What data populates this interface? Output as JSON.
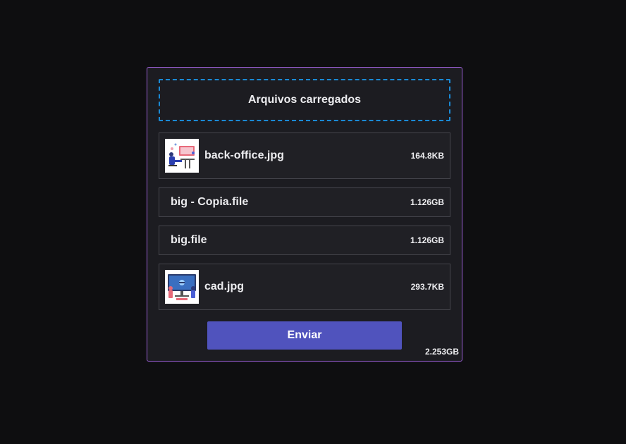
{
  "dropzone": {
    "label": "Arquivos carregados"
  },
  "files": [
    {
      "name": "back-office.jpg",
      "size": "164.8KB",
      "thumbnail": "back-office-illustration"
    },
    {
      "name": "big - Copia.file",
      "size": "1.126GB"
    },
    {
      "name": "big.file",
      "size": "1.126GB"
    },
    {
      "name": "cad.jpg",
      "size": "293.7KB",
      "thumbnail": "cad-illustration"
    }
  ],
  "actions": {
    "send_label": "Enviar"
  },
  "total_size": "2.253GB",
  "colors": {
    "background": "#0e0e10",
    "card": "#1c1c21",
    "card_border": "#9b5fd6",
    "dropzone_border": "#1a8ad6",
    "button": "#5053bd"
  }
}
